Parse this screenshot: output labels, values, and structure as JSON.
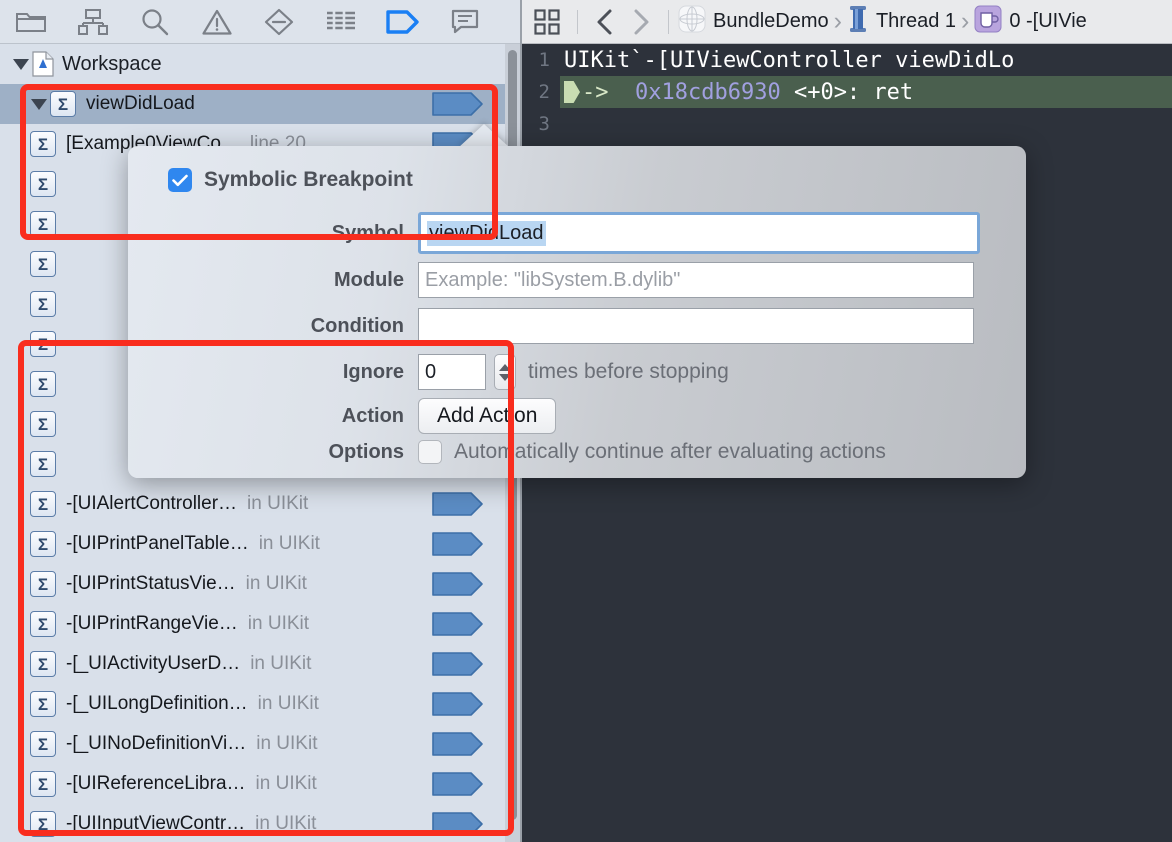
{
  "toolbar": {
    "icons": [
      {
        "name": "folder-icon",
        "label": "Project navigator"
      },
      {
        "name": "hierarchy-icon",
        "label": "Symbol navigator"
      },
      {
        "name": "search-icon",
        "label": "Find navigator"
      },
      {
        "name": "warning-icon",
        "label": "Issue navigator"
      },
      {
        "name": "test-diamond-icon",
        "label": "Test navigator"
      },
      {
        "name": "debug-lines-icon",
        "label": "Debug navigator"
      },
      {
        "name": "breakpoint-icon",
        "label": "Breakpoint navigator"
      },
      {
        "name": "report-icon",
        "label": "Report navigator"
      }
    ]
  },
  "navigator": {
    "workspace": {
      "label": "Workspace",
      "icon": "workspace-document-icon"
    },
    "group": {
      "label": "viewDidLoad",
      "icon": "symbolic-breakpoint-icon",
      "selected": true,
      "enabled": true
    },
    "children": [
      {
        "label": "[Example0ViewCo…",
        "module": "line 20",
        "enabled": true,
        "hidden_by_popover": true
      },
      {
        "label": "",
        "module": "",
        "enabled": true,
        "hidden_by_popover": true
      },
      {
        "label": "",
        "module": "",
        "enabled": true,
        "hidden_by_popover": true
      },
      {
        "label": "",
        "module": "",
        "enabled": true,
        "hidden_by_popover": true
      },
      {
        "label": "",
        "module": "",
        "enabled": true,
        "hidden_by_popover": true
      },
      {
        "label": "",
        "module": "",
        "enabled": true,
        "hidden_by_popover": true
      },
      {
        "label": "",
        "module": "",
        "enabled": true,
        "hidden_by_popover": true
      },
      {
        "label": "",
        "module": "",
        "enabled": true,
        "hidden_by_popover": true
      },
      {
        "label": "",
        "module": "",
        "enabled": true,
        "hidden_by_popover": true
      },
      {
        "label": "-[UIAlertController…",
        "module": "in UIKit",
        "enabled": true
      },
      {
        "label": "-[UIPrintPanelTable…",
        "module": "in UIKit",
        "enabled": true
      },
      {
        "label": "-[UIPrintStatusVie…",
        "module": "in UIKit",
        "enabled": true
      },
      {
        "label": "-[UIPrintRangeVie…",
        "module": "in UIKit",
        "enabled": true
      },
      {
        "label": "-[_UIActivityUserD…",
        "module": "in UIKit",
        "enabled": true
      },
      {
        "label": "-[_UILongDefinition…",
        "module": "in UIKit",
        "enabled": true
      },
      {
        "label": "-[_UINoDefinitionVi…",
        "module": "in UIKit",
        "enabled": true
      },
      {
        "label": "-[UIReferenceLibra…",
        "module": "in UIKit",
        "enabled": true
      },
      {
        "label": "-[UIInputViewContr…",
        "module": "in UIKit",
        "enabled": true
      }
    ]
  },
  "breadcrumb": {
    "grid_button": "grid-view-icon",
    "back_button": "chevron-left-icon",
    "forward_button": "chevron-right-icon",
    "items": [
      {
        "icon": "project-globe-icon",
        "label": "BundleDemo"
      },
      {
        "icon": "thread-spool-icon",
        "label": "Thread 1"
      },
      {
        "icon": "frame-cup-icon",
        "label": "0 -[UIVie"
      }
    ],
    "separator": "›"
  },
  "console": {
    "lines": [
      {
        "number": "1",
        "text": "UIKit`-[UIViewController viewDidLo",
        "kind": "header"
      },
      {
        "number": "2",
        "arrow": "->",
        "address": "0x18cdb6930",
        "rest": "<+0>: ret",
        "kind": "current"
      },
      {
        "number": "3",
        "text": "",
        "kind": "blank"
      }
    ]
  },
  "popover": {
    "checkbox_label": "Symbolic Breakpoint",
    "checkbox_checked": true,
    "fields": [
      {
        "label": "Symbol",
        "value": "viewDidLoad",
        "placeholder": "",
        "focused": true,
        "selected": true
      },
      {
        "label": "Module",
        "value": "",
        "placeholder": "Example: \"libSystem.B.dylib\"",
        "focused": false
      },
      {
        "label": "Condition",
        "value": "",
        "placeholder": "",
        "focused": false
      }
    ],
    "ignore": {
      "label": "Ignore",
      "value": "0",
      "suffix": "times before stopping"
    },
    "action": {
      "label": "Action",
      "button": "Add Action"
    },
    "options": {
      "label": "Options",
      "checkbox_label": "Automatically continue after evaluating actions",
      "checked": false
    }
  },
  "annotations": {
    "color": "#f92d1e",
    "boxes": [
      {
        "name": "highlight-symbolic-breakpoint-row"
      },
      {
        "name": "highlight-uikit-breakpoint-list"
      }
    ]
  }
}
